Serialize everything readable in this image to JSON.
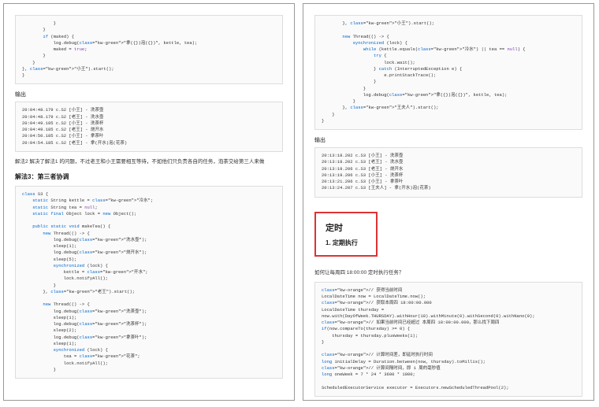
{
  "page_left": {
    "code1": "            }\n        }\n        if (maked) {\n            log.debug(\"拿({})泡({})\", kettle, tea);\n            maked = true;\n        }\n    }\n}, \"小王\").start();\n}",
    "out_label": "输出",
    "out1": "20:04:48.179 c.S2 [小王] - 洗茶壶\n20:04:48.179 c.S2 [老王] - 洗水壶\n20:04:49.185 c.S2 [小王] - 洗茶杯\n20:04:49.185 c.S2 [老王] - 烧开水\n20:04:50.185 c.S2 [小王] - 拿茶叶\n20:04:54.185 c.S2 [老王] - 拿(开水)泡(花茶)",
    "para1": "解法2 解决了解法1 的问题，不过老王和小王需要相互等待，不如他们只负责各自的任务，泡茶交给第三人来做",
    "h2_1": "解法3：第三者协调",
    "code2": "class S3 {\n    static String kettle = \"冷水\";\n    static String tea = null;\n    static final Object lock = new Object();\n\n    public static void makeTea() {\n        new Thread(() -> {\n            log.debug(\"洗水壶\");\n            sleep(1);\n            log.debug(\"烧开水\");\n            sleep(5);\n            synchronized (lock) {\n                kettle = \"开水\";\n                lock.notifyAll();\n            }\n        }, \"老王\").start();\n\n        new Thread(() -> {\n            log.debug(\"洗茶壶\");\n            sleep(1);\n            log.debug(\"洗茶杯\");\n            sleep(2);\n            log.debug(\"拿茶叶\");\n            sleep(1);\n            synchronized (lock) {\n                tea = \"花茶\";\n                lock.notifyAll();\n            }"
  },
  "page_right": {
    "code1": "        }, \"小王\").start();\n\n        new Thread(() -> {\n            synchronized (lock) {\n                while (kettle.equals(\"冷水\") || tea == null) {\n                    try {\n                        lock.wait();\n                    } catch (InterruptedException e) {\n                        e.printStackTrace();\n                    }\n                }\n                log.debug(\"拿({})泡({})\", kettle, tea);\n            }\n        }, \"王夫人\").start();\n    }\n}",
    "out_label": "输出",
    "out1": "20:13:18.202 c.S3 [小王] - 洗茶壶\n20:13:18.202 c.S3 [老王] - 洗水壶\n20:13:19.206 c.S3 [老王] - 烧开水\n20:13:19.206 c.S3 [小王] - 洗茶杯\n20:13:21.206 c.S3 [小王] - 拿茶叶\n20:13:24.207 c.S3 [王夫人] - 拿(开水)泡(花茶)",
    "callout_big": "定时",
    "callout_sub": "1. 定期执行",
    "para1": "如何让每周四 18:00:00 定时执行任务？",
    "code2": "// 获得当前时间\nLocalDateTime now = LocalDateTime.now();\n// 获取本周四 18:00:00.000\nLocalDateTime thursday =\nnow.with(DayOfWeek.THURSDAY).withHour(18).withMinute(0).withSecond(0).withNano(0);\n// 如果当前时间已经超过 本周四 18:00:00.000，那么找下周四\nif(now.compareTo(thursday) >= 0) {\n    thursday = thursday.plusWeeks(1);\n}\n\n// 计算时间差，即延时执行时间\nlong initialDelay = Duration.between(now, thursday).toMillis();\n// 计算间隔时间，即 1 周的毫秒值\nlong oneWeek = 7 * 24 * 3600 * 1000;\n\nScheduledExecutorService executor = Executors.newScheduledThreadPool(2);"
  }
}
